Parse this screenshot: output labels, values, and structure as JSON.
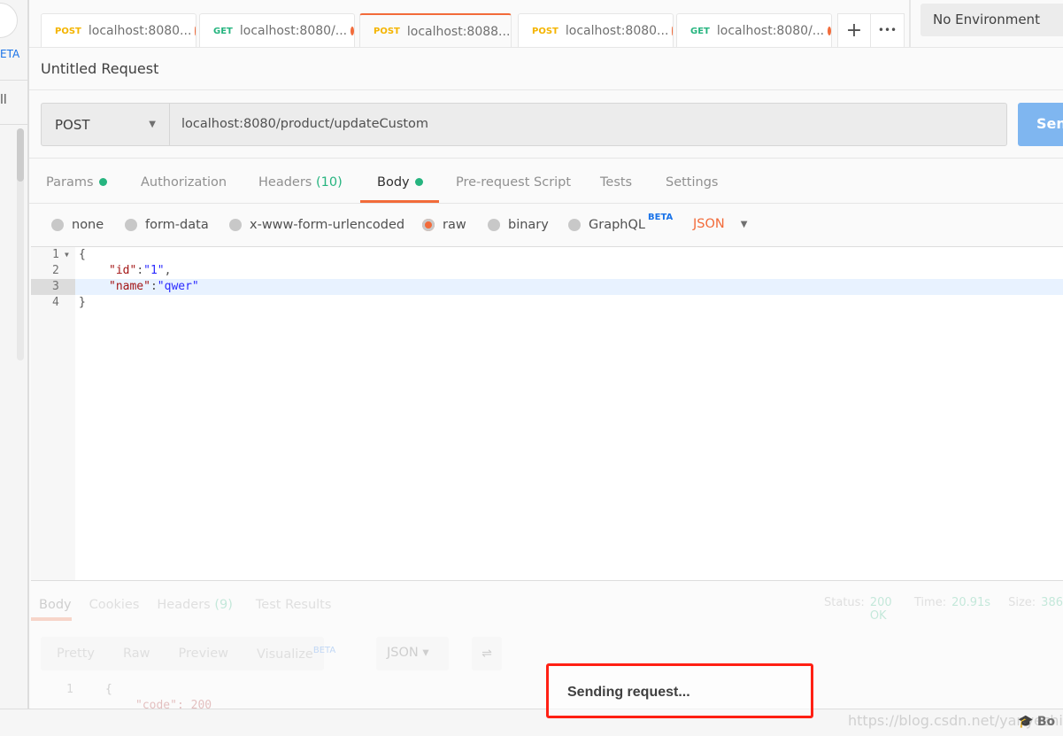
{
  "sidebar": {
    "beta_label": "ETA",
    "item_label": "ll"
  },
  "tabs": [
    {
      "method": "POST",
      "label": "localhost:8080...",
      "active": false
    },
    {
      "method": "GET",
      "label": "localhost:8080/...",
      "active": false
    },
    {
      "method": "POST",
      "label": "localhost:8088...",
      "active": true
    },
    {
      "method": "POST",
      "label": "localhost:8080...",
      "active": false
    },
    {
      "method": "GET",
      "label": "localhost:8080/...",
      "active": false
    }
  ],
  "tab_actions": {
    "add": "+",
    "more": "•••"
  },
  "environment": "No Environment",
  "request": {
    "title": "Untitled Request",
    "method": "POST",
    "url": "localhost:8080/product/updateCustom",
    "send_label": "Send"
  },
  "request_tabs": [
    {
      "label": "Params",
      "dot": true
    },
    {
      "label": "Authorization"
    },
    {
      "label": "Headers",
      "count": "(10)"
    },
    {
      "label": "Body",
      "dot": true,
      "active": true
    },
    {
      "label": "Pre-request Script"
    },
    {
      "label": "Tests"
    },
    {
      "label": "Settings"
    }
  ],
  "body_types": [
    "none",
    "form-data",
    "x-www-form-urlencoded",
    "raw",
    "binary",
    "GraphQL"
  ],
  "body_selected": "raw",
  "graphql_badge": "BETA",
  "format": "JSON",
  "code_lines": [
    "{",
    "\"id\":\"1\",",
    "\"name\":\"qwer\"",
    "}"
  ],
  "response": {
    "tabs": [
      "Body",
      "Cookies",
      "Headers",
      "Test Results"
    ],
    "headers_count": "(9)",
    "status_label": "Status:",
    "status": "200 OK",
    "time_label": "Time:",
    "time": "20.91s",
    "size_label": "Size:",
    "size": "386",
    "views": [
      "Pretty",
      "Raw",
      "Preview",
      "Visualize"
    ],
    "visualize_badge": "BETA",
    "format": "JSON",
    "lines": [
      "{",
      "\"code\": 200"
    ]
  },
  "overlay": "Sending request...",
  "watermark": "https://blog.csdn.net/yanyezhiting",
  "footer": {
    "bootcamp": "Bo"
  },
  "colors": {
    "accent": "#f26b3a",
    "post": "#f4b400",
    "get": "#26b47f",
    "send": "#7fb6f0",
    "highlight": "#ff2014"
  }
}
